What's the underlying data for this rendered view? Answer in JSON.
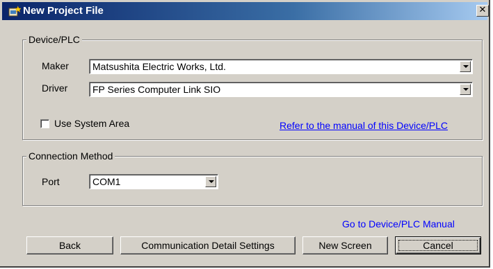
{
  "window": {
    "title": "New Project File"
  },
  "device_group": {
    "label": "Device/PLC",
    "maker_label": "Maker",
    "maker_value": "Matsushita Electric Works, Ltd.",
    "driver_label": "Driver",
    "driver_value": "FP Series Computer Link SIO",
    "use_system_area_label": "Use System Area",
    "use_system_area_checked": false,
    "manual_link": "Refer to the manual of this Device/PLC"
  },
  "connection_group": {
    "label": "Connection Method",
    "port_label": "Port",
    "port_value": "COM1"
  },
  "footer": {
    "manual_link": "Go to Device/PLC Manual",
    "back_label": "Back",
    "comm_settings_label": "Communication Detail Settings",
    "new_screen_label": "New Screen",
    "cancel_label": "Cancel"
  }
}
